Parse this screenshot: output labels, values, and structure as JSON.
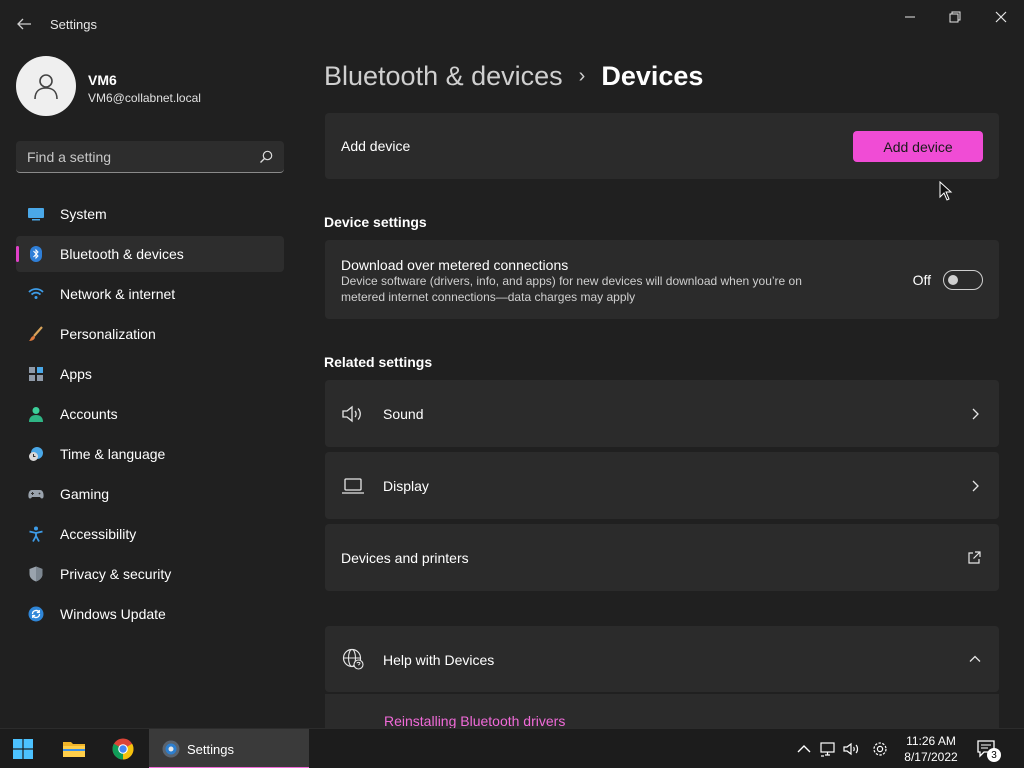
{
  "window": {
    "title": "Settings"
  },
  "profile": {
    "name": "VM6",
    "email": "VM6@collabnet.local"
  },
  "search": {
    "placeholder": "Find a setting"
  },
  "sidebar": {
    "items": [
      {
        "label": "System",
        "icon": "monitor-icon",
        "active": false
      },
      {
        "label": "Bluetooth & devices",
        "icon": "bluetooth-icon",
        "active": true
      },
      {
        "label": "Network & internet",
        "icon": "wifi-icon",
        "active": false
      },
      {
        "label": "Personalization",
        "icon": "brush-icon",
        "active": false
      },
      {
        "label": "Apps",
        "icon": "apps-icon",
        "active": false
      },
      {
        "label": "Accounts",
        "icon": "person-icon",
        "active": false
      },
      {
        "label": "Time & language",
        "icon": "clock-globe-icon",
        "active": false
      },
      {
        "label": "Gaming",
        "icon": "gamepad-icon",
        "active": false
      },
      {
        "label": "Accessibility",
        "icon": "accessibility-icon",
        "active": false
      },
      {
        "label": "Privacy & security",
        "icon": "shield-icon",
        "active": false
      },
      {
        "label": "Windows Update",
        "icon": "update-icon",
        "active": false
      }
    ]
  },
  "breadcrumb": {
    "parent": "Bluetooth & devices",
    "separator": "›",
    "current": "Devices"
  },
  "add_device": {
    "label": "Add device",
    "button": "Add device"
  },
  "device_settings": {
    "title": "Device settings",
    "metered": {
      "title": "Download over metered connections",
      "description": "Device software (drivers, info, and apps) for new devices will download when you’re on metered internet connections—data charges may apply",
      "state": "Off"
    }
  },
  "related": {
    "title": "Related settings",
    "sound": "Sound",
    "display": "Display",
    "printers": "Devices and printers"
  },
  "help": {
    "title": "Help with Devices",
    "link": "Reinstalling Bluetooth drivers"
  },
  "taskbar": {
    "active_app": "Settings",
    "time": "11:26 AM",
    "date": "8/17/2022",
    "notification_count": "3"
  },
  "colors": {
    "accent": "#f04cd5",
    "link": "#f06ad8",
    "background": "#202020",
    "card": "#2b2b2b"
  }
}
